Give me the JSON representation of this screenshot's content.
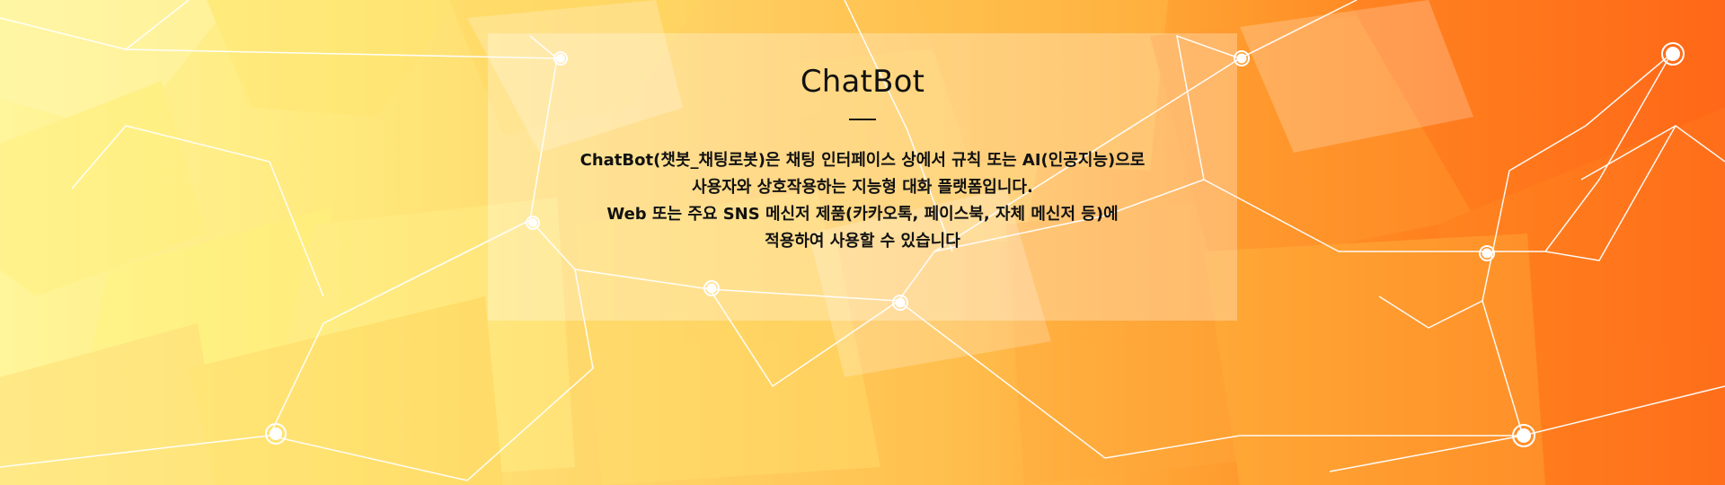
{
  "hero": {
    "title": "ChatBot",
    "description_lines": [
      "ChatBot(챗봇_채팅로봇)은 채팅 인터페이스 상에서 규칙 또는 AI(인공지능)으로",
      "사용자와 상호작용하는 지능형 대화 플랫폼입니다.",
      "Web 또는 주요 SNS 메신저 제품(카카오톡, 페이스북, 자체 메신저 등)에",
      "적용하여 사용할 수 있습니다"
    ]
  },
  "colors": {
    "title_text": "#111111",
    "body_text": "#111111",
    "panel_overlay": "rgba(255,255,255,0.28)",
    "background_light": "#fff59a",
    "background_mid": "#ffbf4d",
    "background_dark": "#ff5a12"
  }
}
